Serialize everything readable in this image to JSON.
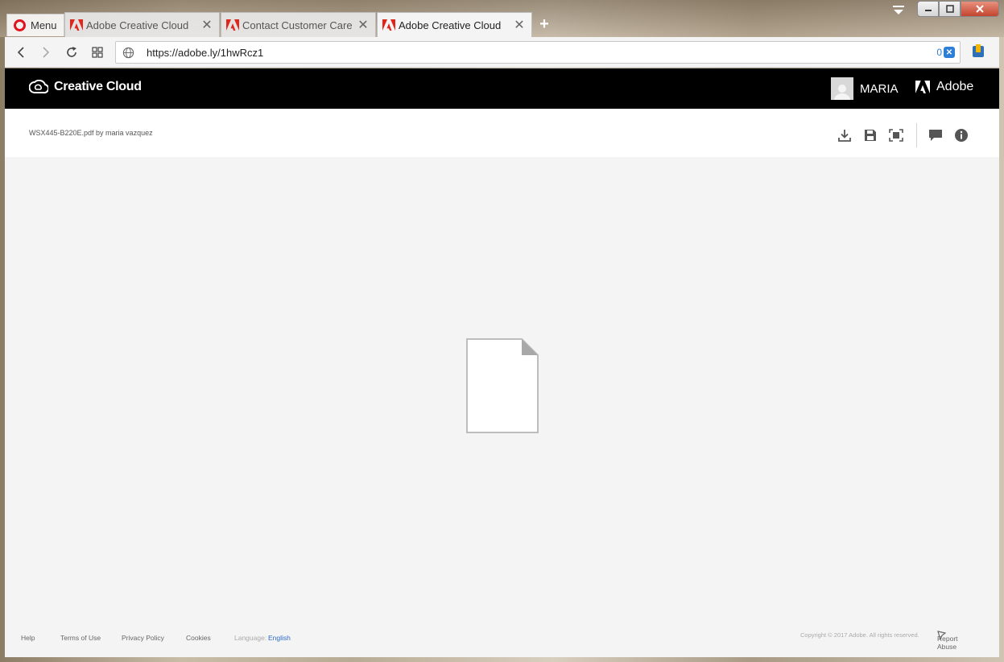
{
  "browser": {
    "menu_label": "Menu",
    "tabs": [
      {
        "title": "Adobe Creative Cloud",
        "close": "✕"
      },
      {
        "title": "Contact Customer Care",
        "close": "✕"
      },
      {
        "title": "Adobe Creative Cloud",
        "close": "✕"
      }
    ],
    "new_tab": "+",
    "url": "https://adobe.ly/1hwRcz1",
    "blocked_count": "0"
  },
  "header": {
    "product": "Creative Cloud",
    "user_name": "MARIA",
    "brand": "Adobe"
  },
  "file": {
    "name": "WSX445-B220E.pdf by maria vazquez"
  },
  "footer": {
    "help": "Help",
    "terms": "Terms of Use",
    "privacy": "Privacy Policy",
    "cookies": "Cookies",
    "language_label": "Language:",
    "language_value": "English",
    "copyright": "Copyright © 2017 Adobe. All rights reserved.",
    "report_abuse": "Report Abuse"
  },
  "colors": {
    "adobe_red": "#e1251b",
    "header_bg": "#000000",
    "page_bg": "#f4f4f4",
    "link_blue": "#2d6cc4"
  }
}
